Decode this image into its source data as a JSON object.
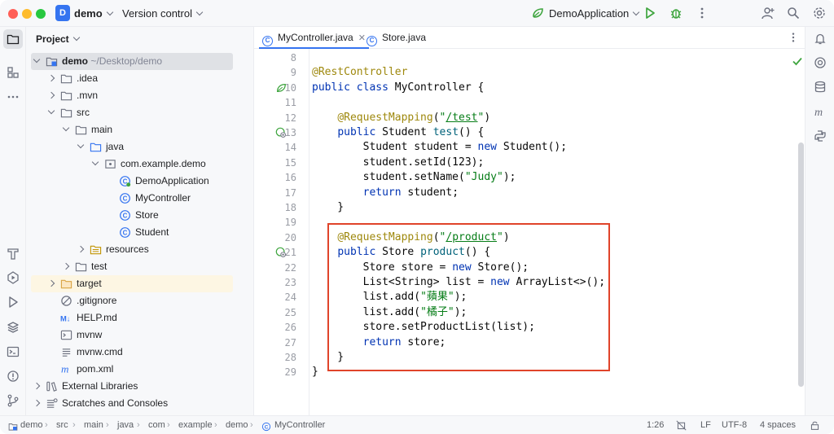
{
  "titlebar": {
    "project_badge": "D",
    "project_name": "demo",
    "vcs_label": "Version control",
    "run_config": "DemoApplication"
  },
  "project_panel": {
    "title": "Project",
    "tree": [
      {
        "label": "demo",
        "extra": " ~/Desktop/demo",
        "depth": 0,
        "arrow": "open",
        "icon": "module-folder-icon",
        "bold": true,
        "state": "selected"
      },
      {
        "label": ".idea",
        "depth": 1,
        "arrow": "closed",
        "icon": "folder-icon"
      },
      {
        "label": ".mvn",
        "depth": 1,
        "arrow": "closed",
        "icon": "folder-icon"
      },
      {
        "label": "src",
        "depth": 1,
        "arrow": "open",
        "icon": "folder-icon"
      },
      {
        "label": "main",
        "depth": 2,
        "arrow": "open",
        "icon": "folder-icon"
      },
      {
        "label": "java",
        "depth": 3,
        "arrow": "open",
        "icon": "source-folder-icon"
      },
      {
        "label": "com.example.demo",
        "depth": 4,
        "arrow": "open",
        "icon": "package-icon"
      },
      {
        "label": "DemoApplication",
        "depth": 5,
        "arrow": "none",
        "icon": "spring-class-icon"
      },
      {
        "label": "MyController",
        "depth": 5,
        "arrow": "none",
        "icon": "class-icon"
      },
      {
        "label": "Store",
        "depth": 5,
        "arrow": "none",
        "icon": "class-icon"
      },
      {
        "label": "Student",
        "depth": 5,
        "arrow": "none",
        "icon": "class-icon"
      },
      {
        "label": "resources",
        "depth": 3,
        "arrow": "closed",
        "icon": "resources-folder-icon"
      },
      {
        "label": "test",
        "depth": 2,
        "arrow": "closed",
        "icon": "folder-icon"
      },
      {
        "label": "target",
        "depth": 1,
        "arrow": "closed",
        "icon": "excluded-folder-icon",
        "state": "highlight"
      },
      {
        "label": ".gitignore",
        "depth": 1,
        "arrow": "none",
        "icon": "ignore-file-icon"
      },
      {
        "label": "HELP.md",
        "depth": 1,
        "arrow": "none",
        "icon": "markdown-icon"
      },
      {
        "label": "mvnw",
        "depth": 1,
        "arrow": "none",
        "icon": "shell-script-icon"
      },
      {
        "label": "mvnw.cmd",
        "depth": 1,
        "arrow": "none",
        "icon": "text-file-icon"
      },
      {
        "label": "pom.xml",
        "depth": 1,
        "arrow": "none",
        "icon": "maven-icon"
      },
      {
        "label": "External Libraries",
        "depth": 0,
        "arrow": "closed",
        "icon": "library-icon"
      },
      {
        "label": "Scratches and Consoles",
        "depth": 0,
        "arrow": "closed",
        "icon": "scratches-icon"
      }
    ]
  },
  "editor": {
    "tabs": [
      {
        "label": "MyController.java",
        "active": true,
        "closable": true
      },
      {
        "label": "Store.java",
        "active": false,
        "closable": false
      }
    ],
    "lines": [
      {
        "n": "8",
        "parts": []
      },
      {
        "n": "9",
        "parts": [
          {
            "t": "a",
            "v": "@RestController"
          }
        ]
      },
      {
        "n": "10",
        "gutter": "spring-bean-icon",
        "parts": [
          {
            "t": "k",
            "v": "public class "
          },
          {
            "t": "p",
            "v": "MyController {"
          }
        ]
      },
      {
        "n": "11",
        "parts": []
      },
      {
        "n": "12",
        "parts": [
          {
            "t": "p",
            "v": "    "
          },
          {
            "t": "a",
            "v": "@RequestMapping"
          },
          {
            "t": "p",
            "v": "("
          },
          {
            "t": "s",
            "v": "\""
          },
          {
            "t": "u",
            "v": "/test"
          },
          {
            "t": "s",
            "v": "\""
          },
          {
            "t": "p",
            "v": ")"
          }
        ]
      },
      {
        "n": "13",
        "gutter": "web-endpoint-icon",
        "parts": [
          {
            "t": "p",
            "v": "    "
          },
          {
            "t": "k",
            "v": "public "
          },
          {
            "t": "p",
            "v": "Student "
          },
          {
            "t": "f",
            "v": "test"
          },
          {
            "t": "p",
            "v": "() {"
          }
        ]
      },
      {
        "n": "14",
        "parts": [
          {
            "t": "p",
            "v": "        Student student = "
          },
          {
            "t": "k",
            "v": "new "
          },
          {
            "t": "p",
            "v": "Student();"
          }
        ]
      },
      {
        "n": "15",
        "parts": [
          {
            "t": "p",
            "v": "        student.setId(123);"
          }
        ]
      },
      {
        "n": "16",
        "parts": [
          {
            "t": "p",
            "v": "        student.setName("
          },
          {
            "t": "s",
            "v": "\"Judy\""
          },
          {
            "t": "p",
            "v": ");"
          }
        ]
      },
      {
        "n": "17",
        "parts": [
          {
            "t": "p",
            "v": "        "
          },
          {
            "t": "k",
            "v": "return "
          },
          {
            "t": "p",
            "v": "student;"
          }
        ]
      },
      {
        "n": "18",
        "parts": [
          {
            "t": "p",
            "v": "    }"
          }
        ]
      },
      {
        "n": "19",
        "parts": []
      },
      {
        "n": "20",
        "parts": [
          {
            "t": "p",
            "v": "    "
          },
          {
            "t": "a",
            "v": "@RequestMapping"
          },
          {
            "t": "p",
            "v": "("
          },
          {
            "t": "s",
            "v": "\""
          },
          {
            "t": "u",
            "v": "/product"
          },
          {
            "t": "s",
            "v": "\""
          },
          {
            "t": "p",
            "v": ")"
          }
        ]
      },
      {
        "n": "21",
        "gutter": "web-endpoint-icon",
        "parts": [
          {
            "t": "p",
            "v": "    "
          },
          {
            "t": "k",
            "v": "public "
          },
          {
            "t": "p",
            "v": "Store "
          },
          {
            "t": "f",
            "v": "product"
          },
          {
            "t": "p",
            "v": "() {"
          }
        ]
      },
      {
        "n": "22",
        "parts": [
          {
            "t": "p",
            "v": "        Store store = "
          },
          {
            "t": "k",
            "v": "new "
          },
          {
            "t": "p",
            "v": "Store();"
          }
        ]
      },
      {
        "n": "23",
        "parts": [
          {
            "t": "p",
            "v": "        List<String> list = "
          },
          {
            "t": "k",
            "v": "new "
          },
          {
            "t": "p",
            "v": "ArrayList<>();"
          }
        ]
      },
      {
        "n": "24",
        "parts": [
          {
            "t": "p",
            "v": "        list.add("
          },
          {
            "t": "s",
            "v": "\"蘋果\""
          },
          {
            "t": "p",
            "v": ");"
          }
        ]
      },
      {
        "n": "25",
        "parts": [
          {
            "t": "p",
            "v": "        list.add("
          },
          {
            "t": "s",
            "v": "\"橘子\""
          },
          {
            "t": "p",
            "v": ");"
          }
        ]
      },
      {
        "n": "26",
        "parts": [
          {
            "t": "p",
            "v": "        store.setProductList(list);"
          }
        ]
      },
      {
        "n": "27",
        "parts": [
          {
            "t": "p",
            "v": "        "
          },
          {
            "t": "k",
            "v": "return "
          },
          {
            "t": "p",
            "v": "store;"
          }
        ]
      },
      {
        "n": "28",
        "parts": [
          {
            "t": "p",
            "v": "    }"
          }
        ]
      },
      {
        "n": "29",
        "parts": [
          {
            "t": "p",
            "v": "}"
          }
        ]
      }
    ]
  },
  "statusbar": {
    "breadcrumbs": [
      "demo",
      "src",
      "main",
      "java",
      "com",
      "example",
      "demo",
      "MyController"
    ],
    "caret": "1:26",
    "line_sep": "LF",
    "encoding": "UTF-8",
    "indent": "4 spaces"
  },
  "colors": {
    "accent": "#3574f0",
    "highlight_box": "#e0442a",
    "run_green": "#3fa53f"
  }
}
